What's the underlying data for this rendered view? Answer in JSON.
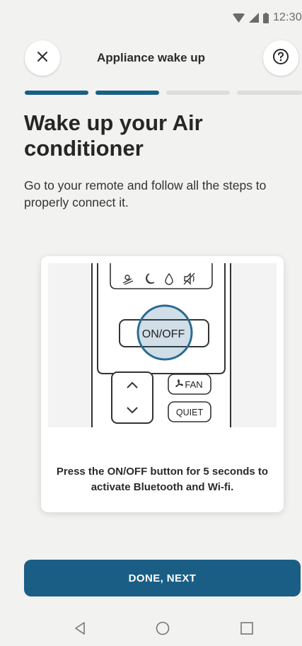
{
  "status_bar": {
    "time": "12:30",
    "icons": [
      "wifi-icon",
      "cellular-signal-icon",
      "battery-icon"
    ]
  },
  "header": {
    "title": "Appliance wake up",
    "close_icon": "close-icon",
    "help_icon": "help-icon"
  },
  "progress": {
    "total_steps": 4,
    "completed_steps": 2
  },
  "main": {
    "title": "Wake up your Air conditioner",
    "description": "Go to your remote and follow all the steps to properly connect it."
  },
  "card": {
    "remote": {
      "onoff_label": "ON/OFF",
      "fan_label": "FAN",
      "quiet_label": "QUIET",
      "top_icons": [
        "swing-icon",
        "sleep-icon",
        "dry-icon",
        "mute-icon"
      ]
    },
    "caption": "Press the ON/OFF button for 5 seconds to activate Bluetooth and Wi-fi."
  },
  "footer": {
    "next_label": "DONE, NEXT"
  },
  "nav": {
    "icons": [
      "back-icon",
      "home-icon",
      "recents-icon"
    ]
  },
  "colors": {
    "accent": "#1b5e85",
    "highlight": "#2a6a92",
    "background": "#f2f2f0",
    "progress_inactive": "#dedede"
  }
}
